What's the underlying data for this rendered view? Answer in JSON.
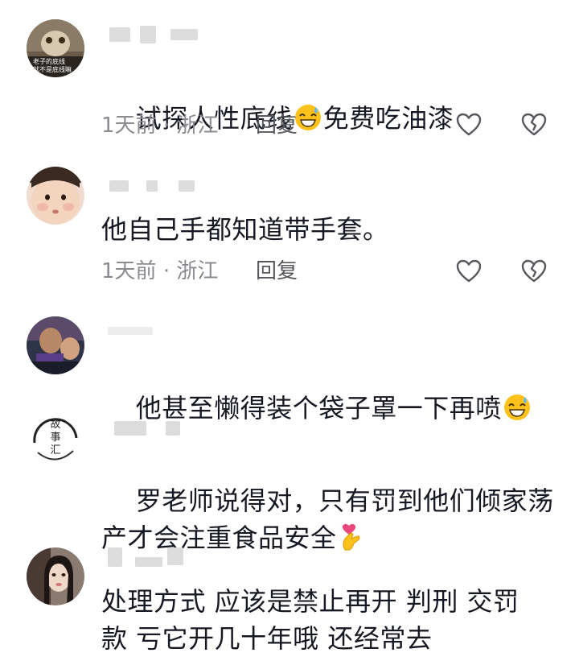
{
  "comments": [
    {
      "text_before": "试探人性底线",
      "emoji": "grinning-sweat-emoji",
      "text_after": "免费吃油漆",
      "time": "1天前",
      "sep": "·",
      "location": "浙江",
      "reply_label": "回复",
      "avatar_caption_1": "老子的底线",
      "avatar_caption_2": "就不是底线嘛"
    },
    {
      "text": "他自己手都知道带手套。",
      "time": "1天前",
      "sep": "·",
      "location": "浙江",
      "reply_label": "回复"
    },
    {
      "text_before": "他甚至懒得装个袋子罩一下再喷",
      "emoji": "grinning-sweat-emoji"
    },
    {
      "text": "罗老师说得对，只有罚到他们倾家荡\n产才会注重食品安全",
      "emoji": "heart-fingers-emoji",
      "avatar_chars": [
        "故",
        "事",
        "汇"
      ]
    },
    {
      "text": "处理方式 应该是禁止再开 判刑 交罚\n款 亏它开几十年哦 还经常去"
    }
  ],
  "icons": {
    "like": "heart-outline-icon",
    "dislike": "broken-heart-icon"
  },
  "colors": {
    "text": "#161823",
    "meta": "#8a8b91",
    "icon": "#57585e"
  }
}
